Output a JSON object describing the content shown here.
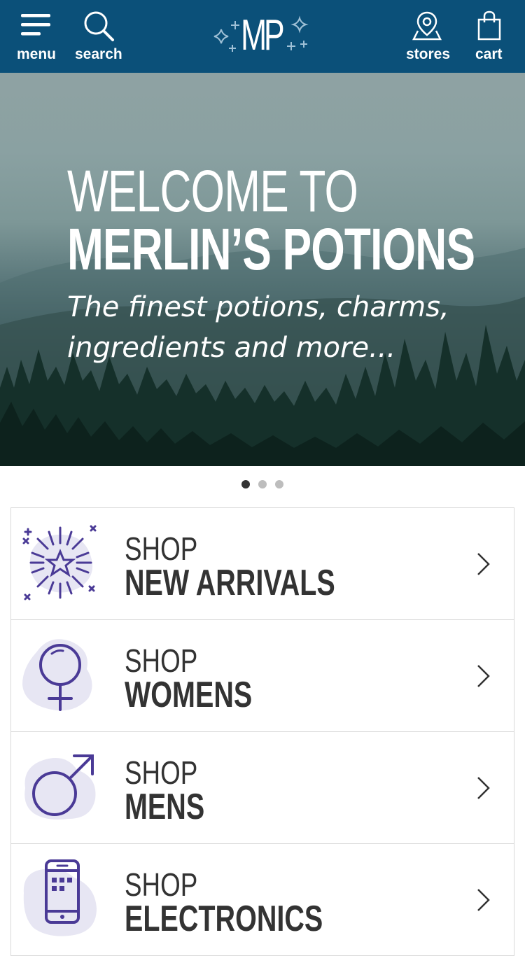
{
  "header": {
    "menu_label": "menu",
    "search_label": "search",
    "logo_text": "MP",
    "stores_label": "stores",
    "cart_label": "cart",
    "background_color": "#0b5079"
  },
  "hero": {
    "line1": "WELCOME TO",
    "line2": "MERLIN’S POTIONS",
    "tagline": "The finest potions, charms,\ningredients and more..."
  },
  "carousel": {
    "slide_count": 3,
    "active_index": 0
  },
  "categories": [
    {
      "prefix": "SHOP",
      "name": "NEW ARRIVALS",
      "icon": "fireworks-star-icon"
    },
    {
      "prefix": "SHOP",
      "name": "WOMENS",
      "icon": "female-symbol-icon"
    },
    {
      "prefix": "SHOP",
      "name": "MENS",
      "icon": "male-symbol-icon"
    },
    {
      "prefix": "SHOP",
      "name": "ELECTRONICS",
      "icon": "smartphone-icon"
    }
  ],
  "colors": {
    "icon_accent": "#4a3a96",
    "icon_blob": "#e7e6f3",
    "text": "#333333"
  }
}
